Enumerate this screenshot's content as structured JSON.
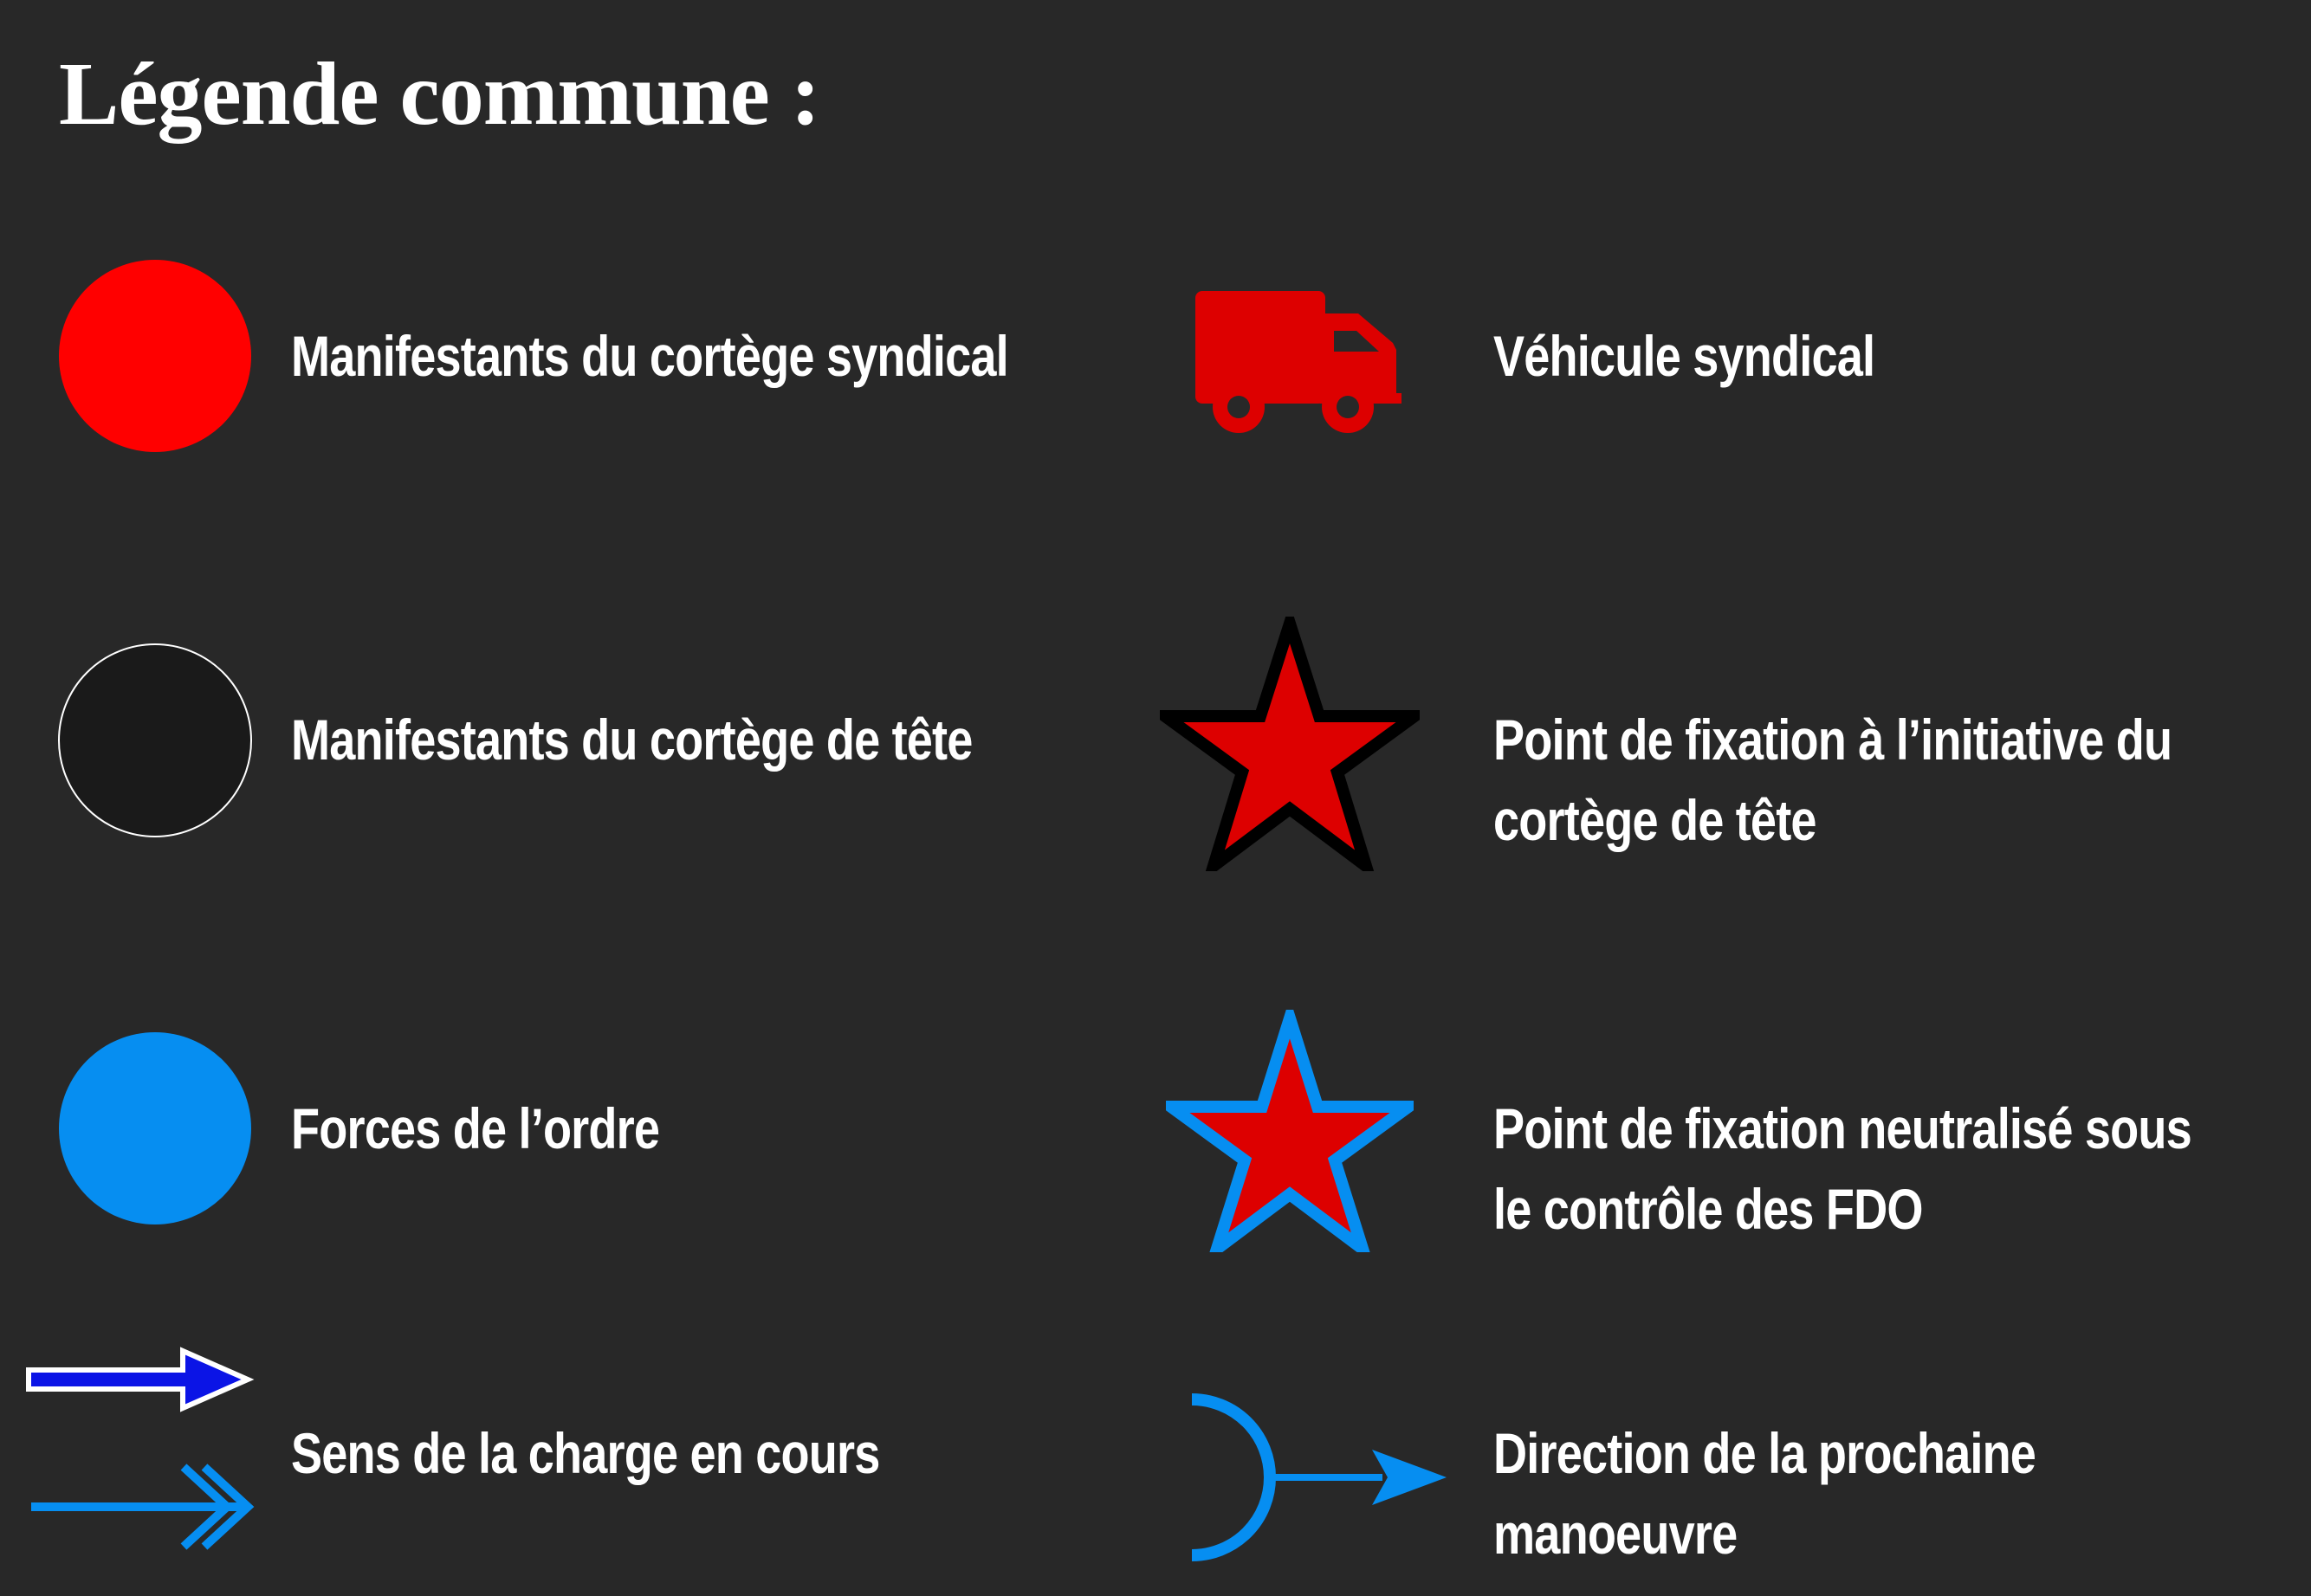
{
  "title": "Légende commune :",
  "legend": {
    "left": [
      {
        "label": "Manifestants du cortège syndical",
        "icon": "red-circle-icon"
      },
      {
        "label": "Manifestants du cortège de tête",
        "icon": "black-circle-icon"
      },
      {
        "label": "Forces de l’ordre",
        "icon": "blue-circle-icon"
      },
      {
        "label": "Sens de la charge en cours",
        "icon": "charge-arrows-icon"
      }
    ],
    "right": [
      {
        "lines": [
          "Véhicule syndical"
        ],
        "icon": "truck-icon"
      },
      {
        "lines": [
          "Point de fixation à l’initiative du",
          "cortège de tête"
        ],
        "icon": "star-black-outline-icon"
      },
      {
        "lines": [
          "Point de fixation neutralisé sous",
          "le contrôle des FDO"
        ],
        "icon": "star-blue-outline-icon"
      },
      {
        "lines": [
          "Direction de la prochaine",
          "manoeuvre"
        ],
        "icon": "maneuver-arrow-icon"
      }
    ]
  },
  "colors": {
    "background": "#282828",
    "syndical_red": "#ff0000",
    "vehicle_red": "#dd0000",
    "tete_black": "#1a1a1a",
    "police_blue": "#068ef1",
    "charge_dark_blue": "#0b14e6",
    "text": "#ffffff"
  }
}
